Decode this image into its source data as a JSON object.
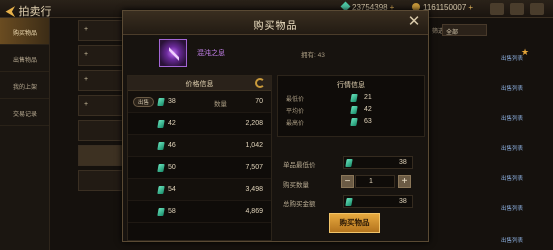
{
  "topbar": {
    "back_label": "拍卖行",
    "gem_amount": "23754398",
    "coin_amount": "1161150007"
  },
  "sidebar": {
    "items": [
      {
        "label": "购买物品",
        "active": true
      },
      {
        "label": "出售物品",
        "active": false
      },
      {
        "label": "我的上架",
        "active": false
      },
      {
        "label": "交易记录",
        "active": false
      }
    ]
  },
  "background": {
    "filter_label": "筛选中",
    "filter_value": "全部",
    "stall_label": "出售列表"
  },
  "modal": {
    "title": "购买物品",
    "close": "✕",
    "item_name": "混沌之息",
    "owned_label": "拥有:",
    "owned_value": "43",
    "price_panel": {
      "title": "价格信息",
      "onsale_tag": "出售",
      "qty_label": "数量",
      "rows": [
        {
          "price": "38",
          "qty": "70"
        },
        {
          "price": "42",
          "qty": "2,208"
        },
        {
          "price": "46",
          "qty": "1,042"
        },
        {
          "price": "50",
          "qty": "7,507"
        },
        {
          "price": "54",
          "qty": "3,498"
        },
        {
          "price": "58",
          "qty": "4,869"
        }
      ]
    },
    "market": {
      "title": "行情信息",
      "min_label": "最低价",
      "min_value": "21",
      "avg_label": "平均价",
      "avg_value": "42",
      "max_label": "最高价",
      "max_value": "63"
    },
    "purchase": {
      "unit_min_label": "单品最低价",
      "unit_min_value": "38",
      "qty_label": "购买数量",
      "qty_value": "1",
      "total_label": "总购买金额",
      "total_value": "38",
      "buy_button": "购买物品"
    }
  },
  "colors": {
    "accent": "#e7a93f",
    "gem": "#4ec9a6",
    "item_purple": "#c783f0"
  }
}
